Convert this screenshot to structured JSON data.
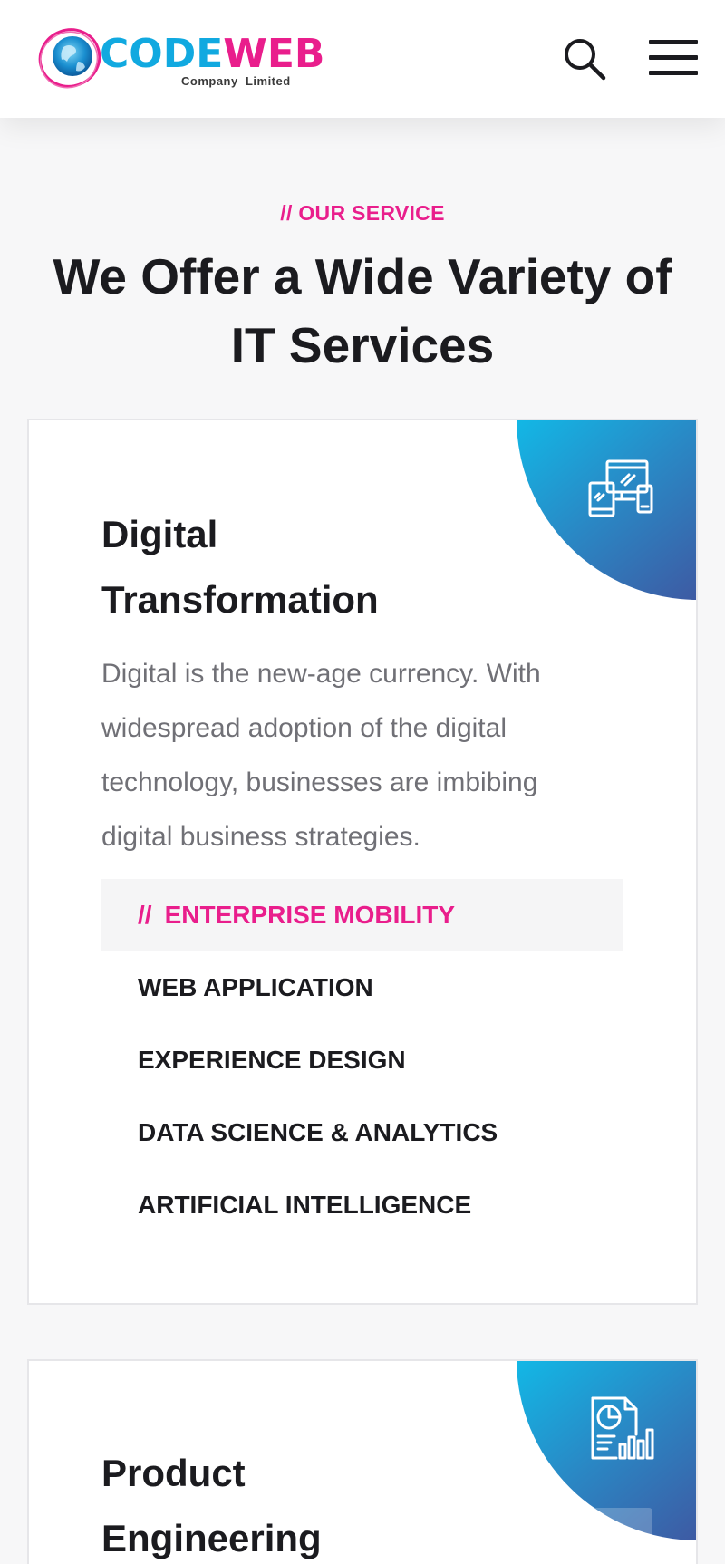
{
  "header": {
    "logo": {
      "brand_part1": "CODE",
      "brand_part2": "WEB",
      "tagline": "Company  Limited"
    },
    "icons": {
      "search": "search-icon",
      "menu": "hamburger-menu-icon"
    }
  },
  "section": {
    "eyebrow": "// OUR SERVICE",
    "title": "We Offer a Wide Variety of IT Services"
  },
  "cards": [
    {
      "title_line1": "Digital",
      "title_line2": "Transformation",
      "icon": "devices-icon",
      "description": "Digital is the new-age currency. With widespread adoption of the digital technology, businesses are imbibing digital business strategies.",
      "items": [
        {
          "prefix": "//",
          "label": "ENTERPRISE MOBILITY",
          "active": true
        },
        {
          "label": "WEB APPLICATION"
        },
        {
          "label": "EXPERIENCE DESIGN"
        },
        {
          "label": "DATA SCIENCE & ANALYTICS"
        },
        {
          "label": "ARTIFICIAL INTELLIGENCE"
        }
      ]
    },
    {
      "title_line1": "Product",
      "title_line2": "Engineering",
      "icon": "report-chart-icon"
    }
  ],
  "colors": {
    "accent": "#e91e8c",
    "brand_blue": "#11a9e0",
    "gradient_start": "#12b8e6",
    "gradient_end": "#3e5aa3",
    "text_dark": "#1b1b1f",
    "text_muted": "#707076"
  }
}
